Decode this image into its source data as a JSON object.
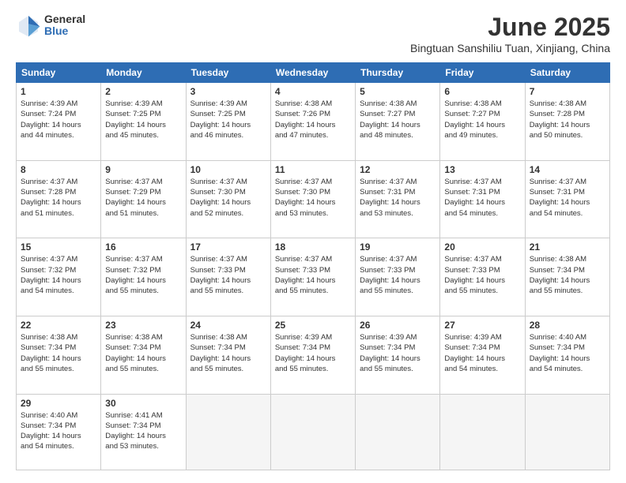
{
  "logo": {
    "general": "General",
    "blue": "Blue"
  },
  "title": "June 2025",
  "location": "Bingtuan Sanshiliu Tuan, Xinjiang, China",
  "weekdays": [
    "Sunday",
    "Monday",
    "Tuesday",
    "Wednesday",
    "Thursday",
    "Friday",
    "Saturday"
  ],
  "weeks": [
    [
      {
        "day": "1",
        "sunrise": "Sunrise: 4:39 AM",
        "sunset": "Sunset: 7:24 PM",
        "daylight": "Daylight: 14 hours and 44 minutes."
      },
      {
        "day": "2",
        "sunrise": "Sunrise: 4:39 AM",
        "sunset": "Sunset: 7:25 PM",
        "daylight": "Daylight: 14 hours and 45 minutes."
      },
      {
        "day": "3",
        "sunrise": "Sunrise: 4:39 AM",
        "sunset": "Sunset: 7:25 PM",
        "daylight": "Daylight: 14 hours and 46 minutes."
      },
      {
        "day": "4",
        "sunrise": "Sunrise: 4:38 AM",
        "sunset": "Sunset: 7:26 PM",
        "daylight": "Daylight: 14 hours and 47 minutes."
      },
      {
        "day": "5",
        "sunrise": "Sunrise: 4:38 AM",
        "sunset": "Sunset: 7:27 PM",
        "daylight": "Daylight: 14 hours and 48 minutes."
      },
      {
        "day": "6",
        "sunrise": "Sunrise: 4:38 AM",
        "sunset": "Sunset: 7:27 PM",
        "daylight": "Daylight: 14 hours and 49 minutes."
      },
      {
        "day": "7",
        "sunrise": "Sunrise: 4:38 AM",
        "sunset": "Sunset: 7:28 PM",
        "daylight": "Daylight: 14 hours and 50 minutes."
      }
    ],
    [
      {
        "day": "8",
        "sunrise": "Sunrise: 4:37 AM",
        "sunset": "Sunset: 7:28 PM",
        "daylight": "Daylight: 14 hours and 51 minutes."
      },
      {
        "day": "9",
        "sunrise": "Sunrise: 4:37 AM",
        "sunset": "Sunset: 7:29 PM",
        "daylight": "Daylight: 14 hours and 51 minutes."
      },
      {
        "day": "10",
        "sunrise": "Sunrise: 4:37 AM",
        "sunset": "Sunset: 7:30 PM",
        "daylight": "Daylight: 14 hours and 52 minutes."
      },
      {
        "day": "11",
        "sunrise": "Sunrise: 4:37 AM",
        "sunset": "Sunset: 7:30 PM",
        "daylight": "Daylight: 14 hours and 53 minutes."
      },
      {
        "day": "12",
        "sunrise": "Sunrise: 4:37 AM",
        "sunset": "Sunset: 7:31 PM",
        "daylight": "Daylight: 14 hours and 53 minutes."
      },
      {
        "day": "13",
        "sunrise": "Sunrise: 4:37 AM",
        "sunset": "Sunset: 7:31 PM",
        "daylight": "Daylight: 14 hours and 54 minutes."
      },
      {
        "day": "14",
        "sunrise": "Sunrise: 4:37 AM",
        "sunset": "Sunset: 7:31 PM",
        "daylight": "Daylight: 14 hours and 54 minutes."
      }
    ],
    [
      {
        "day": "15",
        "sunrise": "Sunrise: 4:37 AM",
        "sunset": "Sunset: 7:32 PM",
        "daylight": "Daylight: 14 hours and 54 minutes."
      },
      {
        "day": "16",
        "sunrise": "Sunrise: 4:37 AM",
        "sunset": "Sunset: 7:32 PM",
        "daylight": "Daylight: 14 hours and 55 minutes."
      },
      {
        "day": "17",
        "sunrise": "Sunrise: 4:37 AM",
        "sunset": "Sunset: 7:33 PM",
        "daylight": "Daylight: 14 hours and 55 minutes."
      },
      {
        "day": "18",
        "sunrise": "Sunrise: 4:37 AM",
        "sunset": "Sunset: 7:33 PM",
        "daylight": "Daylight: 14 hours and 55 minutes."
      },
      {
        "day": "19",
        "sunrise": "Sunrise: 4:37 AM",
        "sunset": "Sunset: 7:33 PM",
        "daylight": "Daylight: 14 hours and 55 minutes."
      },
      {
        "day": "20",
        "sunrise": "Sunrise: 4:37 AM",
        "sunset": "Sunset: 7:33 PM",
        "daylight": "Daylight: 14 hours and 55 minutes."
      },
      {
        "day": "21",
        "sunrise": "Sunrise: 4:38 AM",
        "sunset": "Sunset: 7:34 PM",
        "daylight": "Daylight: 14 hours and 55 minutes."
      }
    ],
    [
      {
        "day": "22",
        "sunrise": "Sunrise: 4:38 AM",
        "sunset": "Sunset: 7:34 PM",
        "daylight": "Daylight: 14 hours and 55 minutes."
      },
      {
        "day": "23",
        "sunrise": "Sunrise: 4:38 AM",
        "sunset": "Sunset: 7:34 PM",
        "daylight": "Daylight: 14 hours and 55 minutes."
      },
      {
        "day": "24",
        "sunrise": "Sunrise: 4:38 AM",
        "sunset": "Sunset: 7:34 PM",
        "daylight": "Daylight: 14 hours and 55 minutes."
      },
      {
        "day": "25",
        "sunrise": "Sunrise: 4:39 AM",
        "sunset": "Sunset: 7:34 PM",
        "daylight": "Daylight: 14 hours and 55 minutes."
      },
      {
        "day": "26",
        "sunrise": "Sunrise: 4:39 AM",
        "sunset": "Sunset: 7:34 PM",
        "daylight": "Daylight: 14 hours and 55 minutes."
      },
      {
        "day": "27",
        "sunrise": "Sunrise: 4:39 AM",
        "sunset": "Sunset: 7:34 PM",
        "daylight": "Daylight: 14 hours and 54 minutes."
      },
      {
        "day": "28",
        "sunrise": "Sunrise: 4:40 AM",
        "sunset": "Sunset: 7:34 PM",
        "daylight": "Daylight: 14 hours and 54 minutes."
      }
    ],
    [
      {
        "day": "29",
        "sunrise": "Sunrise: 4:40 AM",
        "sunset": "Sunset: 7:34 PM",
        "daylight": "Daylight: 14 hours and 54 minutes."
      },
      {
        "day": "30",
        "sunrise": "Sunrise: 4:41 AM",
        "sunset": "Sunset: 7:34 PM",
        "daylight": "Daylight: 14 hours and 53 minutes."
      },
      null,
      null,
      null,
      null,
      null
    ]
  ]
}
